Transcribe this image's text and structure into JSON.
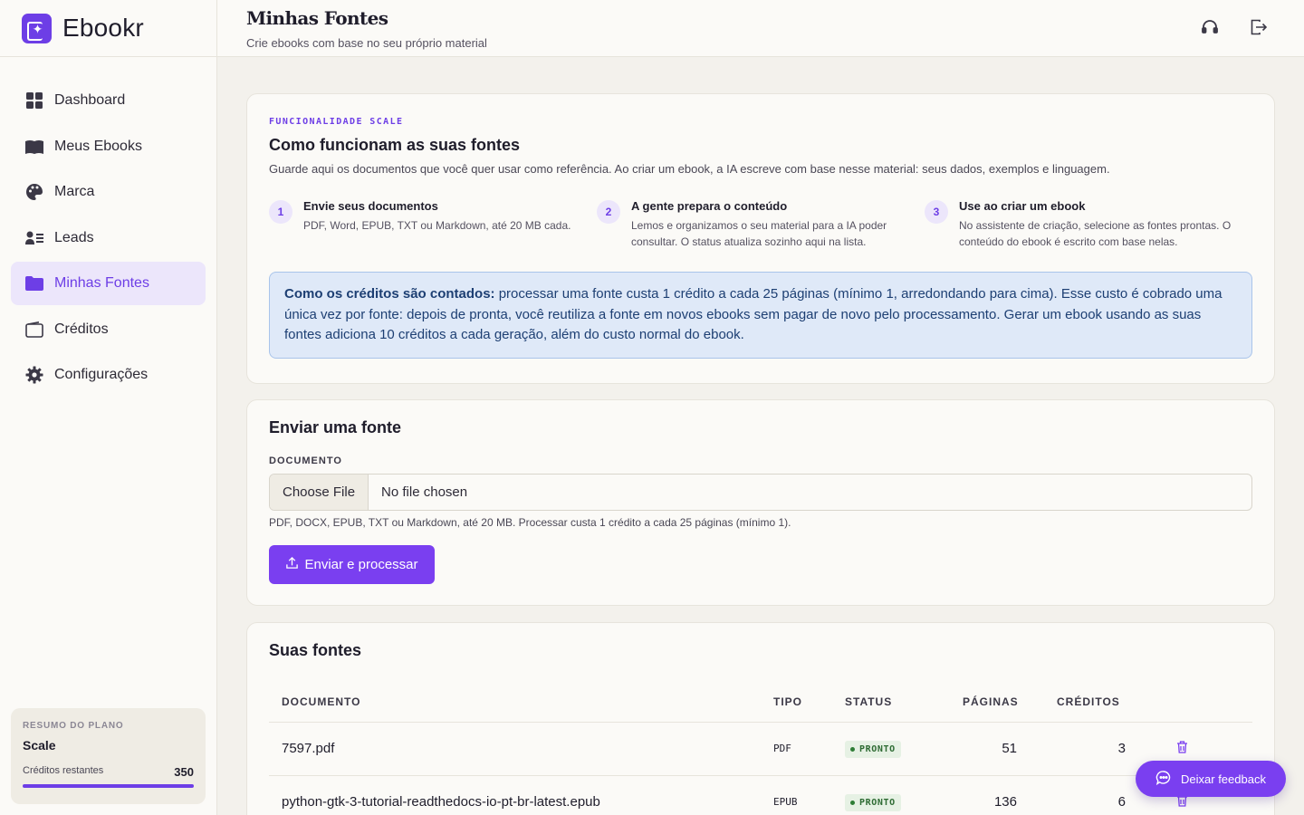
{
  "brand": {
    "name": "Ebookr"
  },
  "sidebar": {
    "items": [
      {
        "label": "Dashboard",
        "icon": "grid-icon"
      },
      {
        "label": "Meus Ebooks",
        "icon": "book-icon"
      },
      {
        "label": "Marca",
        "icon": "palette-icon"
      },
      {
        "label": "Leads",
        "icon": "user-list-icon"
      },
      {
        "label": "Minhas Fontes",
        "icon": "folder-icon",
        "active": true
      },
      {
        "label": "Créditos",
        "icon": "wallet-icon"
      },
      {
        "label": "Configurações",
        "icon": "gear-icon"
      }
    ],
    "plan": {
      "label": "RESUMO DO PLANO",
      "name": "Scale",
      "credits_label": "Créditos restantes",
      "credits_value": "350",
      "progress_fraction": 1.0
    }
  },
  "header": {
    "title": "Minhas Fontes",
    "subtitle": "Crie ebooks com base no seu próprio material"
  },
  "how": {
    "eyebrow": "FUNCIONALIDADE SCALE",
    "title": "Como funcionam as suas fontes",
    "description": "Guarde aqui os documentos que você quer usar como referência. Ao criar um ebook, a IA escreve com base nesse material: seus dados, exemplos e linguagem.",
    "steps": [
      {
        "num": "1",
        "title": "Envie seus documentos",
        "desc": "PDF, Word, EPUB, TXT ou Markdown, até 20 MB cada."
      },
      {
        "num": "2",
        "title": "A gente prepara o conteúdo",
        "desc": "Lemos e organizamos o seu material para a IA poder consultar. O status atualiza sozinho aqui na lista."
      },
      {
        "num": "3",
        "title": "Use ao criar um ebook",
        "desc": "No assistente de criação, selecione as fontes prontas. O conteúdo do ebook é escrito com base nelas."
      }
    ],
    "info_bold": "Como os créditos são contados:",
    "info_text": " processar uma fonte custa 1 crédito a cada 25 páginas (mínimo 1, arredondando para cima). Esse custo é cobrado uma única vez por fonte: depois de pronta, você reutiliza a fonte em novos ebooks sem pagar de novo pelo processamento. Gerar um ebook usando as suas fontes adiciona 10 créditos a cada geração, além do custo normal do ebook."
  },
  "upload": {
    "title": "Enviar uma fonte",
    "field_label": "DOCUMENTO",
    "choose_label": "Choose File",
    "no_file": "No file chosen",
    "hint": "PDF, DOCX, EPUB, TXT ou Markdown, até 20 MB. Processar custa 1 crédito a cada 25 páginas (mínimo 1).",
    "submit_label": "Enviar e processar"
  },
  "sources": {
    "title": "Suas fontes",
    "columns": [
      "DOCUMENTO",
      "TIPO",
      "STATUS",
      "PÁGINAS",
      "CRÉDITOS"
    ],
    "rows": [
      {
        "name": "7597.pdf",
        "type": "PDF",
        "status": "PRONTO",
        "pages": "51",
        "credits": "3"
      },
      {
        "name": "python-gtk-3-tutorial-readthedocs-io-pt-br-latest.epub",
        "type": "EPUB",
        "status": "PRONTO",
        "pages": "136",
        "credits": "6"
      }
    ]
  },
  "feedback": {
    "label": "Deixar feedback"
  },
  "colors": {
    "accent": "#6d3ee6",
    "info_bg": "#dfe9f8",
    "success": "#2e7d36"
  }
}
